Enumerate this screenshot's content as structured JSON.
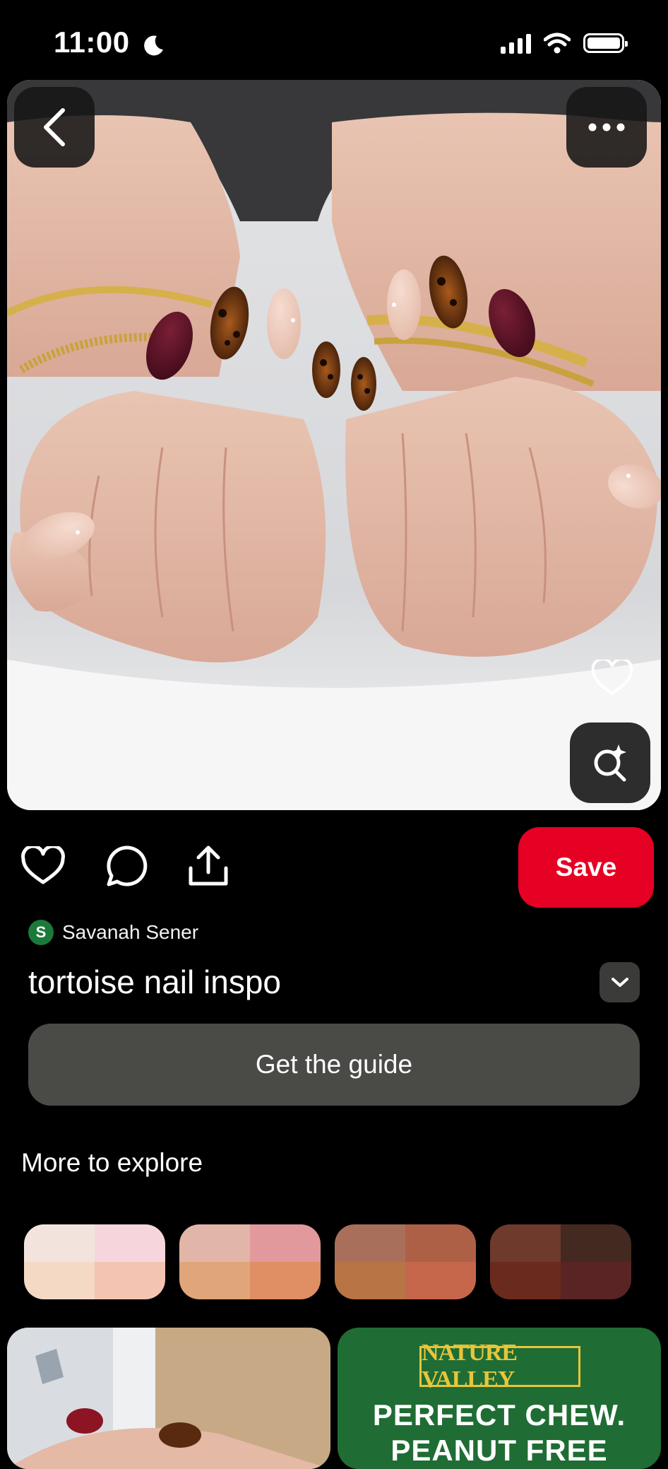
{
  "status_bar": {
    "time": "11:00",
    "icons": [
      "moon-icon",
      "signal-icon",
      "wifi-icon",
      "battery-icon"
    ]
  },
  "pin": {
    "image_description_icons": [
      "back-arrow-icon",
      "more-icon",
      "visual-search-icon",
      "heart-outline-icon"
    ],
    "author_initial": "S",
    "author_name": "Savanah Sener",
    "title": "tortoise nail inspo",
    "save_label": "Save",
    "guide_label": "Get the guide"
  },
  "actions": {
    "icons": [
      "like-icon",
      "comment-icon",
      "share-icon"
    ]
  },
  "explore": {
    "title": "More to explore",
    "palettes": [
      [
        "#f2e4dc",
        "#f6d6dc",
        "#f4d9c4",
        "#f3c4b2"
      ],
      [
        "#e1b6a8",
        "#e2999c",
        "#e0a67a",
        "#e08e64"
      ],
      [
        "#a8705a",
        "#ae6046",
        "#b87444",
        "#c6674c"
      ],
      [
        "#6e3a2c",
        "#43291f",
        "#6b2a1e",
        "#5a2424"
      ]
    ]
  },
  "feed": {
    "ad_brand": "NATURE VALLEY",
    "ad_line1": "PERFECT CHEW.",
    "ad_line2": "PEANUT FREE"
  },
  "colors": {
    "save_red": "#e60023",
    "button_gray": "#4a4b47",
    "background": "#000000"
  }
}
